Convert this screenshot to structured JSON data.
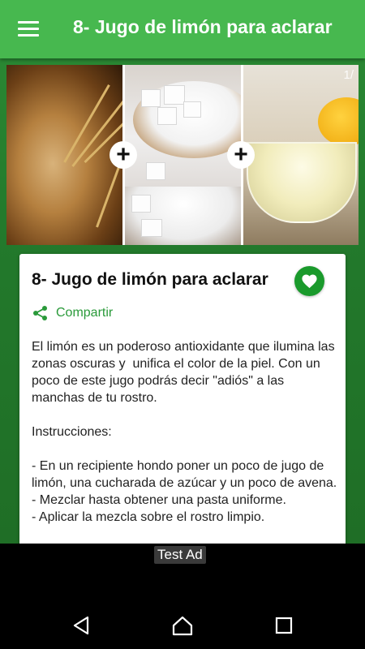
{
  "toolbar": {
    "title": "8- Jugo de limón para aclarar",
    "menu_icon": "hamburger-menu-icon"
  },
  "gallery": {
    "counter": "1/",
    "images": [
      "oats-image",
      "sugar-image",
      "lemon-juice-image"
    ],
    "separator_icon": "plus-icon"
  },
  "card": {
    "title": "8- Jugo de limón para aclarar",
    "favorite_icon": "heart-icon",
    "share_label": "Compartir",
    "share_icon": "share-icon",
    "paragraphs": [
      "El limón es un poderoso antioxidante que ilumina las zonas oscuras y  unifica el color de la piel. Con un poco de este jugo podrás decir \"adiós\" a las  manchas de tu rostro.",
      "",
      "Instrucciones:",
      "",
      "- En un recipiente hondo poner un poco de jugo de limón, una cucharada de azúcar y un poco de avena.",
      "- Mezclar hasta obtener una pasta uniforme.",
      "- Aplicar la mezcla sobre el rostro limpio."
    ]
  },
  "ad": {
    "label": "Test Ad"
  },
  "colors": {
    "toolbar": "#47b84f",
    "background": "#237a2c",
    "accent": "#1a9a2c",
    "share_text": "#2a9a3a"
  },
  "navbar": {
    "back_icon": "back-triangle-icon",
    "home_icon": "home-icon",
    "recents_icon": "recents-square-icon"
  }
}
